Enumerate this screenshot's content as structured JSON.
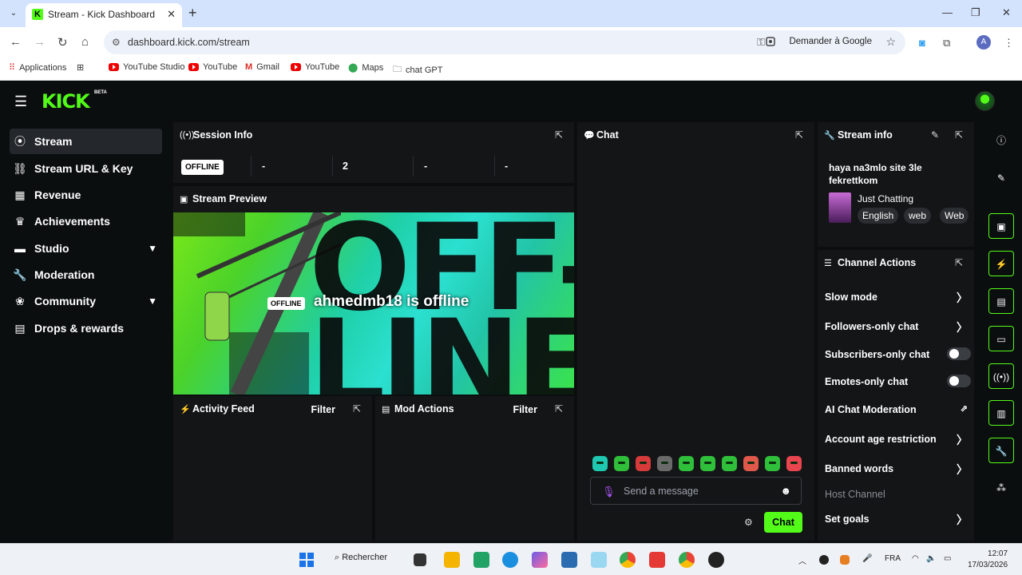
{
  "browser": {
    "tab_title": "Stream - Kick Dashboard",
    "url": "dashboard.kick.com/stream",
    "ask_google": "Demander à Google",
    "profile_initial": "A",
    "bookmarks": [
      "Applications",
      "YouTube Studio",
      "YouTube",
      "Gmail",
      "YouTube",
      "Maps",
      "chat GPT"
    ]
  },
  "app": {
    "logo": "KICK",
    "logo_badge": "BETA",
    "brand_color": "#53fc18"
  },
  "sidebar": {
    "items": [
      {
        "label": "Stream",
        "icon": "broadcast-icon",
        "active": true
      },
      {
        "label": "Stream URL & Key",
        "icon": "link-icon"
      },
      {
        "label": "Revenue",
        "icon": "chart-icon"
      },
      {
        "label": "Achievements",
        "icon": "trophy-icon"
      },
      {
        "label": "Studio",
        "icon": "studio-icon",
        "expandable": true
      },
      {
        "label": "Moderation",
        "icon": "wrench-icon"
      },
      {
        "label": "Community",
        "icon": "globe-icon",
        "expandable": true
      },
      {
        "label": "Drops & rewards",
        "icon": "gift-icon"
      }
    ]
  },
  "session_info": {
    "title": "Session Info",
    "status_badge": "OFFLINE",
    "stats": [
      "-",
      "2",
      "-",
      "-"
    ]
  },
  "stream_preview": {
    "title": "Stream Preview",
    "badge": "OFFLINE",
    "message": "ahmedmb18 is offline"
  },
  "activity_feed": {
    "title": "Activity Feed",
    "filter": "Filter"
  },
  "mod_actions": {
    "title": "Mod Actions",
    "filter": "Filter"
  },
  "chat": {
    "title": "Chat",
    "placeholder": "Send a message",
    "send_label": "Chat"
  },
  "stream_info": {
    "title": "Stream info",
    "stream_title": "haya na3mlo site 3le fekrettkom",
    "category": "Just Chatting",
    "tags": [
      "English",
      "web",
      "Web"
    ]
  },
  "channel_actions": {
    "title": "Channel Actions",
    "items": [
      {
        "label": "Slow mode",
        "control": "chevron"
      },
      {
        "label": "Followers-only chat",
        "control": "chevron"
      },
      {
        "label": "Subscribers-only chat",
        "control": "toggle",
        "on": false
      },
      {
        "label": "Emotes-only chat",
        "control": "toggle",
        "on": false
      },
      {
        "label": "AI Chat Moderation",
        "control": "external"
      },
      {
        "label": "Account age restriction",
        "control": "chevron"
      },
      {
        "label": "Banned words",
        "control": "chevron"
      },
      {
        "label": "Host Channel",
        "control": "none",
        "disabled": true
      },
      {
        "label": "Set goals",
        "control": "chevron"
      }
    ]
  },
  "taskbar": {
    "search": "Rechercher",
    "language": "FRA",
    "time": "12:07",
    "date": "17/03/2026"
  }
}
